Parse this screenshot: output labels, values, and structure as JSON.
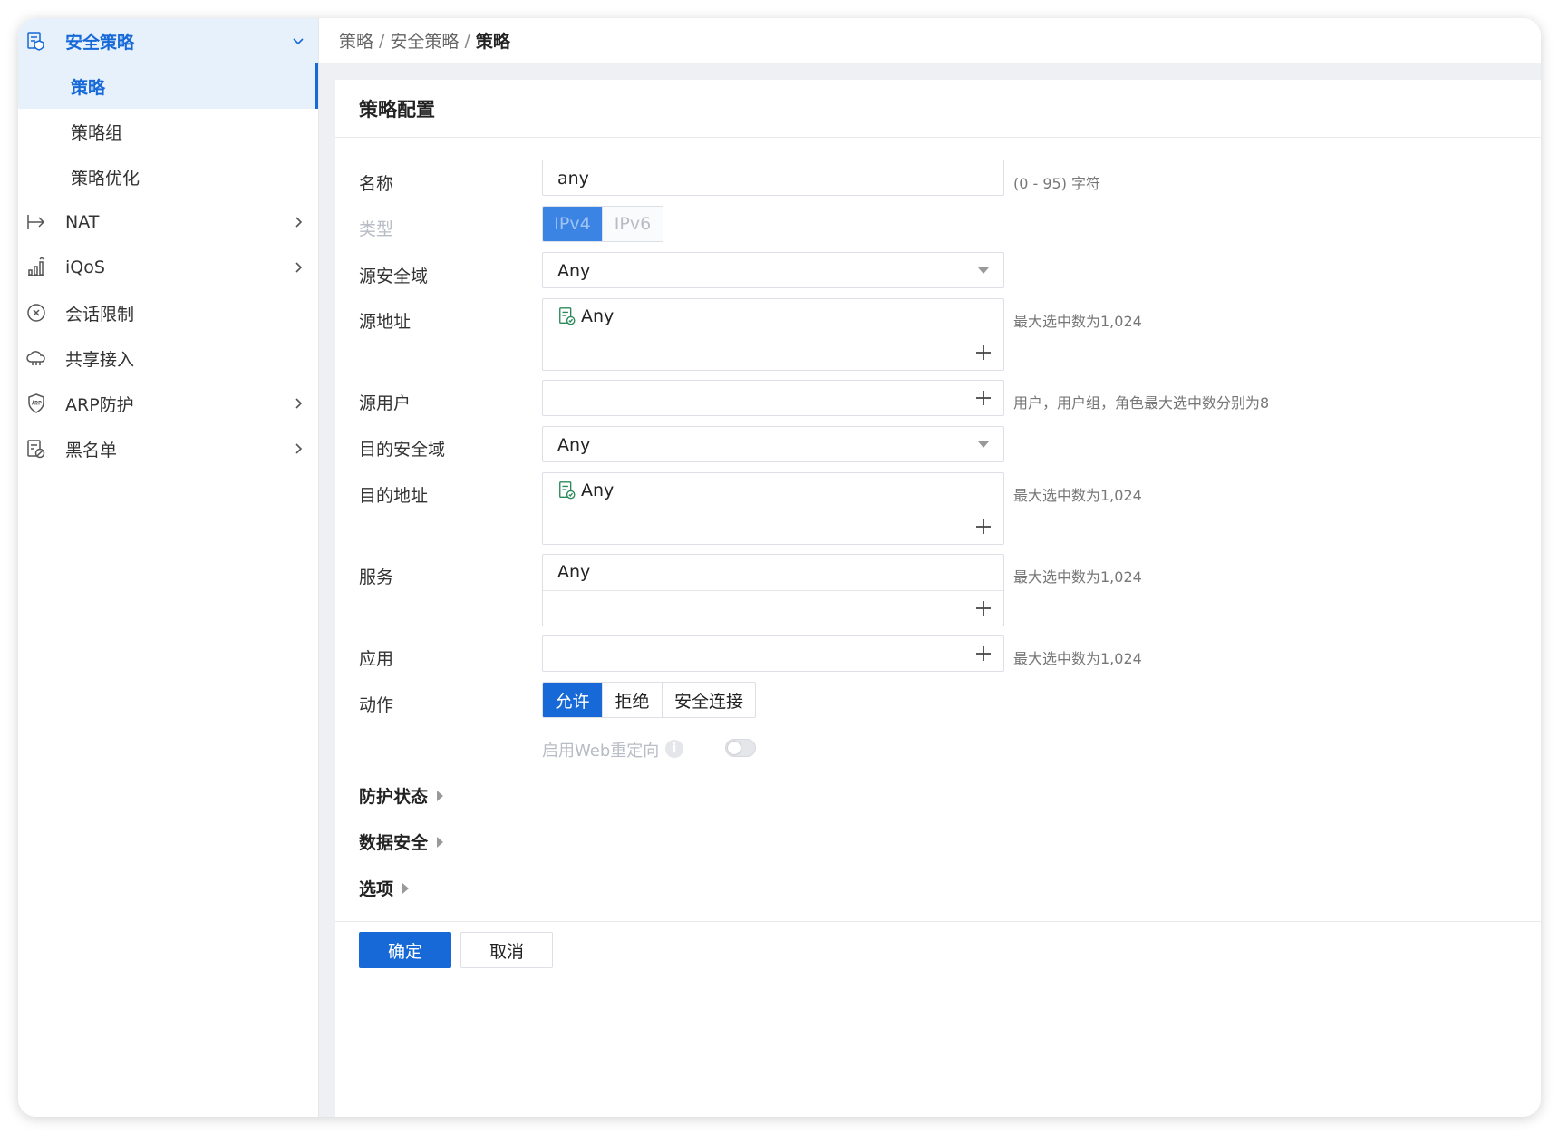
{
  "sidebar": {
    "security_policy": "安全策略",
    "sub_items": [
      "策略",
      "策略组",
      "策略优化"
    ],
    "items": [
      "NAT",
      "iQoS",
      "会话限制",
      "共享接入",
      "ARP防护",
      "黑名单"
    ]
  },
  "breadcrumb": {
    "level1": "策略",
    "sep": "/",
    "level2": "安全策略",
    "current": "策略"
  },
  "panel": {
    "title": "策略配置"
  },
  "form": {
    "name_label": "名称",
    "name_value": "any",
    "name_hint": "(0 - 95) 字符",
    "type_label": "类型",
    "type_options": [
      "IPv4",
      "IPv6"
    ],
    "src_zone_label": "源安全域",
    "src_zone_value": "Any",
    "src_addr_label": "源地址",
    "src_addr_value": "Any",
    "src_addr_hint": "最大选中数为1,024",
    "src_user_label": "源用户",
    "src_user_hint": "用户，用户组，角色最大选中数分别为8",
    "dst_zone_label": "目的安全域",
    "dst_zone_value": "Any",
    "dst_addr_label": "目的地址",
    "dst_addr_value": "Any",
    "dst_addr_hint": "最大选中数为1,024",
    "service_label": "服务",
    "service_value": "Any",
    "service_hint": "最大选中数为1,024",
    "app_label": "应用",
    "app_hint": "最大选中数为1,024",
    "action_label": "动作",
    "action_options": [
      "允许",
      "拒绝",
      "安全连接"
    ],
    "web_redirect_label": "启用Web重定向",
    "info_glyph": "i"
  },
  "sections": [
    "防护状态",
    "数据安全",
    "选项"
  ],
  "buttons": {
    "ok": "确定",
    "cancel": "取消"
  },
  "colors": {
    "accent": "#1769d8",
    "active_bg": "#e6f1fc",
    "address_icon": "#2c8a5a"
  }
}
